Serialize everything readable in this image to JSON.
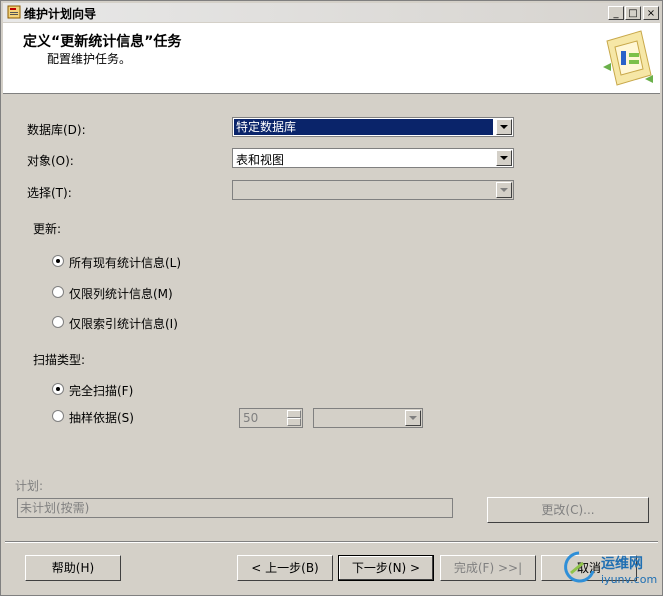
{
  "window": {
    "title": "维护计划向导"
  },
  "title_buttons": {
    "minimize": "_",
    "maximize": "□",
    "close": "×"
  },
  "header": {
    "title": "定义“更新统计信息”任务",
    "subtitle": "配置维护任务。"
  },
  "form": {
    "database_label": "数据库(D):",
    "database_value": "特定数据库",
    "object_label": "对象(O):",
    "object_value": "表和视图",
    "selection_label": "选择(T):",
    "selection_value": "",
    "update_label": "更新:",
    "update_options": [
      {
        "label": "所有现有统计信息(L)",
        "selected": true
      },
      {
        "label": "仅限列统计信息(M)",
        "selected": false
      },
      {
        "label": "仅限索引统计信息(I)",
        "selected": false
      }
    ],
    "scan_label": "扫描类型:",
    "scan_options": [
      {
        "label": "完全扫描(F)",
        "selected": true
      },
      {
        "label": "抽样依据(S)",
        "selected": false
      }
    ],
    "sample_value": "50",
    "sample_unit": ""
  },
  "schedule": {
    "label": "计划:",
    "value": "未计划(按需)",
    "change_button": "更改(C)..."
  },
  "footer": {
    "help": "帮助(H)",
    "back": "< 上一步(B)",
    "next": "下一步(N) >",
    "finish": "完成(F) >>|",
    "cancel": "取消"
  },
  "watermark": {
    "text1": "运维网",
    "text2": "iyunv.com"
  }
}
